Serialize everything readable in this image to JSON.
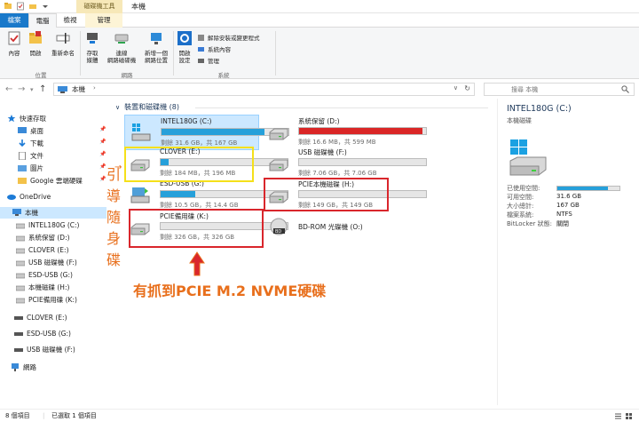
{
  "window": {
    "title": "本機",
    "contextual_tab_title": "磁碟機工具"
  },
  "tabs": [
    "檔案",
    "電腦",
    "檢視",
    "管理"
  ],
  "ribbon": {
    "location_buttons": [
      {
        "label": "內容",
        "icon": "check-properties-icon"
      },
      {
        "label": "開啟",
        "icon": "folder-open-icon"
      },
      {
        "label": "重新命名",
        "icon": "rename-icon"
      }
    ],
    "location_group": "位置",
    "network_buttons": [
      {
        "label": "存取\n媒體",
        "icon": "media-access-icon"
      },
      {
        "label": "連線\n網路磁碟機",
        "icon": "map-network-drive-icon"
      },
      {
        "label": "新增一個\n網路位置",
        "icon": "add-network-location-icon"
      }
    ],
    "network_group": "網路",
    "system_buttons": [
      {
        "label": "開啟\n設定",
        "icon": "gear-icon"
      }
    ],
    "system_small": [
      {
        "label": "解除安裝或變更程式",
        "icon": "uninstall-icon"
      },
      {
        "label": "系統內容",
        "icon": "system-properties-icon"
      },
      {
        "label": "管理",
        "icon": "manage-icon"
      }
    ],
    "system_group": "系統"
  },
  "address": {
    "crumb": "本機",
    "search_placeholder": "搜尋 本機"
  },
  "nav": {
    "items": [
      {
        "label": "快速存取",
        "icon": "star-icon",
        "pinned": false
      },
      {
        "label": "桌面",
        "icon": "desktop-icon",
        "pinned": true
      },
      {
        "label": "下載",
        "icon": "download-icon",
        "pinned": true
      },
      {
        "label": "文件",
        "icon": "document-icon",
        "pinned": true
      },
      {
        "label": "圖片",
        "icon": "picture-icon",
        "pinned": true
      },
      {
        "label": "Google 雲端硬碟",
        "icon": "google-drive-icon",
        "pinned": true
      },
      {
        "label": "OneDrive",
        "icon": "onedrive-icon",
        "pinned": false
      },
      {
        "label": "本機",
        "icon": "pc-icon",
        "pinned": false
      },
      {
        "label": "INTEL180G (C:)",
        "icon": "drive-icon",
        "pinned": false
      },
      {
        "label": "系統保留 (D:)",
        "icon": "drive-icon",
        "pinned": false
      },
      {
        "label": "CLOVER (E:)",
        "icon": "drive-icon",
        "pinned": false
      },
      {
        "label": "USB 磁碟機 (F:)",
        "icon": "drive-icon",
        "pinned": false
      },
      {
        "label": "ESD-USB (G:)",
        "icon": "drive-icon",
        "pinned": false
      },
      {
        "label": "本機磁碟 (H:)",
        "icon": "drive-icon",
        "pinned": false
      },
      {
        "label": "PCIE備用碟 (K:)",
        "icon": "drive-icon",
        "pinned": false
      },
      {
        "label": "CLOVER (E:)",
        "icon": "usb-drive-icon",
        "pinned": false
      },
      {
        "label": "ESD-USB (G:)",
        "icon": "usb-drive-icon",
        "pinned": false
      },
      {
        "label": "USB 磁碟機 (F:)",
        "icon": "usb-drive-icon",
        "pinned": false
      },
      {
        "label": "網路",
        "icon": "network-icon",
        "pinned": false
      }
    ]
  },
  "content": {
    "group_title": "裝置和磁碟機 (8)",
    "drives": [
      {
        "name": "INTEL180G (C:)",
        "size": "剩餘 31.6 GB，共 167 GB",
        "used": 0.81,
        "full": false,
        "icon": "windows-drive-icon"
      },
      {
        "name": "系統保留 (D:)",
        "size": "剩餘 16.6 MB，共 599 MB",
        "used": 0.97,
        "full": true,
        "icon": "drive-icon"
      },
      {
        "name": "CLOVER (E:)",
        "size": "剩餘 184 MB，共 196 MB",
        "used": 0.06,
        "full": false,
        "icon": "drive-icon"
      },
      {
        "name": "USB 磁碟機 (F:)",
        "size": "剩餘 7.06 GB，共 7.06 GB",
        "used": 0.0,
        "full": false,
        "icon": "drive-icon"
      },
      {
        "name": "ESD-USB (G:)",
        "size": "剩餘 10.5 GB，共 14.4 GB",
        "used": 0.27,
        "full": false,
        "icon": "esd-usb-drive-icon"
      },
      {
        "name": "PCIE本機磁碟 (H:)",
        "size": "剩餘 149 GB，共 149 GB",
        "used": 0.0,
        "full": false,
        "icon": "drive-icon"
      },
      {
        "name": "PCIE備用碟 (K:)",
        "size": "剩餘 326 GB，共 326 GB",
        "used": 0.0,
        "full": false,
        "icon": "drive-icon"
      },
      {
        "name": "BD-ROM 光碟機 (O:)",
        "size": "",
        "used": null,
        "full": false,
        "icon": "bd-rom-icon"
      }
    ]
  },
  "annotations": {
    "vertical": [
      "引",
      "導",
      "隨",
      "身",
      "碟"
    ],
    "main": "有抓到PCIE M.2 NVME硬碟",
    "colors": {
      "yellow": "#f5e01a",
      "red": "#d9262c",
      "orange": "#e86f1c"
    }
  },
  "details": {
    "title": "INTEL180G (C:)",
    "subtitle": "本機磁碟",
    "used_fraction": 0.81,
    "rows": [
      {
        "k": "已使用空間:",
        "v": ""
      },
      {
        "k": "可用空間:",
        "v": "31.6 GB"
      },
      {
        "k": "大小總計:",
        "v": "167 GB"
      },
      {
        "k": "檔案系統:",
        "v": "NTFS"
      },
      {
        "k": "BitLocker 狀態:",
        "v": "關閉"
      }
    ]
  },
  "status": {
    "count": "8 個項目",
    "selected": "已選取 1 個項目"
  }
}
